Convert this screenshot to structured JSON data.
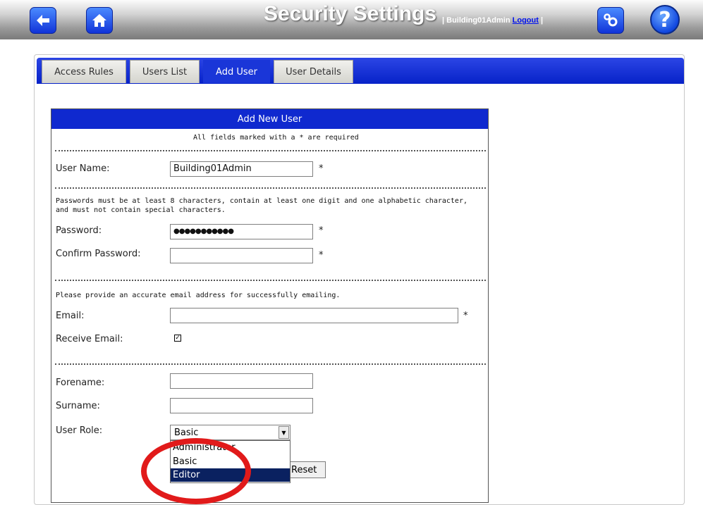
{
  "header": {
    "title": "Security Settings",
    "user_prefix": "| Building01Admin ",
    "logout_label": "Logout",
    "user_suffix": " |",
    "back_icon": "back-arrow-icon",
    "home_icon": "home-icon",
    "settings_icon": "gears-icon",
    "help_label": "?"
  },
  "tabs": [
    {
      "label": "Access Rules",
      "active": false
    },
    {
      "label": "Users List",
      "active": false
    },
    {
      "label": "Add User",
      "active": true
    },
    {
      "label": "User Details",
      "active": false
    }
  ],
  "form": {
    "title": "Add New User",
    "required_note": "All fields marked with a * are required",
    "username_label": "User Name:",
    "username_value": "Building01Admin",
    "password_note": "Passwords must be at least 8 characters, contain at least one digit and one alphabetic character, and must not contain special characters.",
    "password_label": "Password:",
    "password_value": "●●●●●●●●●●●",
    "confirm_label": "Confirm Password:",
    "confirm_value": "",
    "email_note": "Please provide an accurate email address for successfully emailing.",
    "email_label": "Email:",
    "email_value": "",
    "receive_email_label": "Receive Email:",
    "receive_email_checked": true,
    "check_mark": "✓",
    "forename_label": "Forename:",
    "forename_value": "",
    "surname_label": "Surname:",
    "surname_value": "",
    "role_label": "User Role:",
    "role_selected": "Basic",
    "role_options": [
      "Administrator",
      "Basic",
      "Editor"
    ],
    "role_highlighted": "Editor",
    "required_mark": "*",
    "reset_label": "Reset"
  },
  "colors": {
    "brand_blue": "#0f29cf",
    "annotation_red": "#e11a1a"
  }
}
